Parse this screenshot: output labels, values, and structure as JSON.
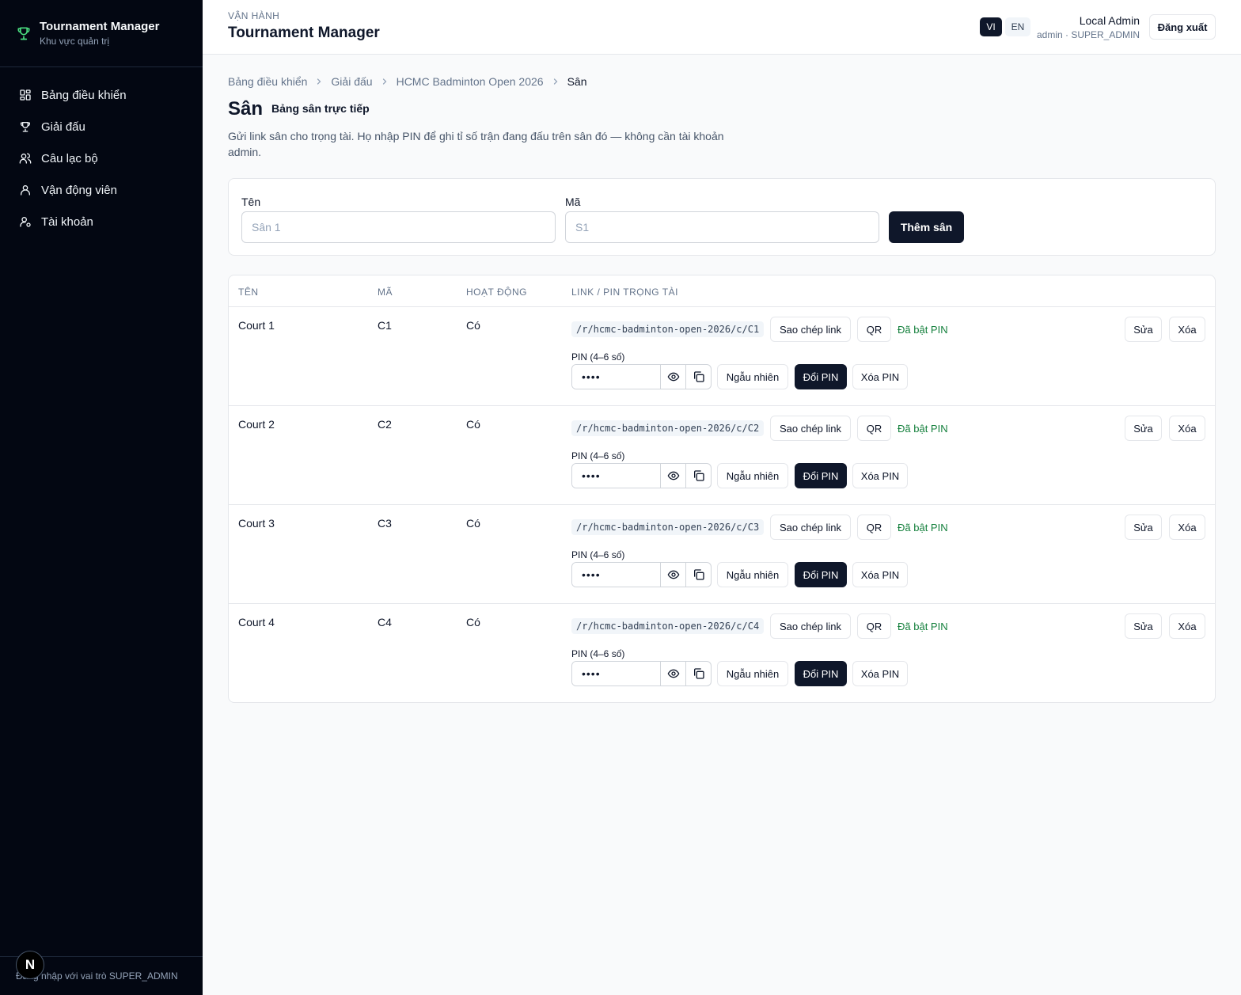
{
  "sidebar": {
    "brand_title": "Tournament Manager",
    "brand_subtitle": "Khu vực quản trị",
    "items": [
      {
        "label": "Bảng điều khiển",
        "icon": "dashboard-icon"
      },
      {
        "label": "Giải đấu",
        "icon": "trophy-icon"
      },
      {
        "label": "Câu lạc bộ",
        "icon": "users-icon"
      },
      {
        "label": "Vận động viên",
        "icon": "user-icon"
      },
      {
        "label": "Tài khoản",
        "icon": "user-settings-icon"
      }
    ],
    "footer": "Đăng nhập với vai trò SUPER_ADMIN",
    "badge": "N"
  },
  "header": {
    "kicker": "VẬN HÀNH",
    "title": "Tournament Manager",
    "lang_vi": "VI",
    "lang_en": "EN",
    "user_name": "Local Admin",
    "user_role": "admin · SUPER_ADMIN",
    "logout": "Đăng xuất"
  },
  "breadcrumb": [
    "Bảng điều khiển",
    "Giải đấu",
    "HCMC Badminton Open 2026",
    "Sân"
  ],
  "page": {
    "title": "Sân",
    "subtitle": "Bảng sân trực tiếp",
    "description": "Gửi link sân cho trọng tài. Họ nhập PIN để ghi tỉ số trận đang đấu trên sân đó — không cần tài khoản admin."
  },
  "form": {
    "name_label": "Tên",
    "name_placeholder": "Sân 1",
    "code_label": "Mã",
    "code_placeholder": "S1",
    "add_button": "Thêm sân"
  },
  "table": {
    "headers": [
      "TÊN",
      "MÃ",
      "HOẠT ĐỘNG",
      "LINK / PIN TRỌNG TÀI"
    ],
    "copy_link": "Sao chép link",
    "qr": "QR",
    "pin_status": "Đã bật PIN",
    "pin_label": "PIN (4–6 số)",
    "pin_mask": "••••",
    "random": "Ngẫu nhiên",
    "change_pin": "Đổi PIN",
    "delete_pin": "Xóa PIN",
    "edit": "Sửa",
    "delete": "Xóa",
    "rows": [
      {
        "name": "Court 1",
        "code": "C1",
        "active": "Có",
        "link": "/r/hcmc-badminton-open-2026/c/C1"
      },
      {
        "name": "Court 2",
        "code": "C2",
        "active": "Có",
        "link": "/r/hcmc-badminton-open-2026/c/C2"
      },
      {
        "name": "Court 3",
        "code": "C3",
        "active": "Có",
        "link": "/r/hcmc-badminton-open-2026/c/C3"
      },
      {
        "name": "Court 4",
        "code": "C4",
        "active": "Có",
        "link": "/r/hcmc-badminton-open-2026/c/C4"
      }
    ]
  },
  "colors": {
    "sidebar_bg": "#030712",
    "primary": "#0f172a",
    "pin_status": "#15803d",
    "brand_icon": "#4ade80"
  }
}
